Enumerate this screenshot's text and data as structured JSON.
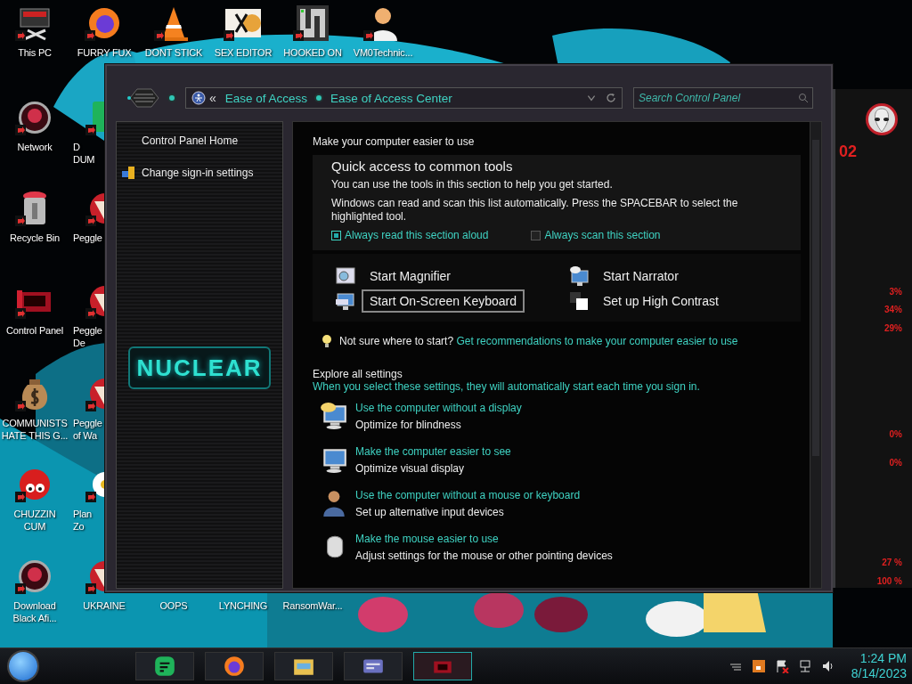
{
  "desktop": {
    "icons": [
      {
        "lines": [
          "This PC"
        ]
      },
      {
        "lines": [
          "FURRY FUX"
        ]
      },
      {
        "lines": [
          "DONT STICK"
        ]
      },
      {
        "lines": [
          "SEX EDITOR"
        ]
      },
      {
        "lines": [
          "HOOKED ON"
        ]
      },
      {
        "lines": [
          "VM0Technic..."
        ]
      },
      {
        "lines": [
          "Network"
        ]
      },
      {
        "lines": [
          "Recycle Bin"
        ]
      },
      {
        "lines": [
          "Control Panel"
        ]
      },
      {
        "lines": [
          "COMMUNISTS",
          "HATE THIS G..."
        ]
      },
      {
        "lines": [
          "CHUZZIN",
          "CUM"
        ]
      },
      {
        "lines": [
          "Download",
          "Black Afi..."
        ]
      },
      {
        "lines": [
          "D",
          "DUM"
        ]
      },
      {
        "lines": [
          "Peggle"
        ]
      },
      {
        "lines": [
          "Peggle",
          "De"
        ]
      },
      {
        "lines": [
          "Peggle",
          "of Wa"
        ]
      },
      {
        "lines": [
          "Plan",
          "Zo"
        ]
      },
      {
        "lines": [
          "UKRAINE"
        ]
      },
      {
        "lines": [
          "OOPS"
        ]
      },
      {
        "lines": [
          "LYNCHING"
        ]
      },
      {
        "lines": [
          "RansomWar..."
        ]
      }
    ]
  },
  "window": {
    "address_bar": {
      "back_glyph": "«",
      "crumbs": [
        "Ease of Access",
        "Ease of Access Center"
      ]
    },
    "search": {
      "placeholder": "Search Control Panel"
    },
    "sidebar": {
      "items": [
        {
          "label": "Control Panel Home"
        },
        {
          "label": "Change sign-in settings"
        }
      ],
      "logo": "NUCLEAR"
    },
    "main": {
      "heading": "Make your computer easier to use",
      "quick_access": {
        "title": "Quick access to common tools",
        "intro": "You can use the tools in this section to help you get started.",
        "note": "Windows can read and scan this list automatically.  Press the SPACEBAR to select the highlighted tool.",
        "options": [
          {
            "label": "Always read this section aloud",
            "checked": true
          },
          {
            "label": "Always scan this section",
            "checked": false
          }
        ]
      },
      "tools": [
        {
          "label": "Start Magnifier",
          "focused": false
        },
        {
          "label": "Start Narrator",
          "focused": false
        },
        {
          "label": "Start On-Screen Keyboard",
          "focused": true
        },
        {
          "label": "Set up High Contrast",
          "focused": false
        }
      ],
      "tip": {
        "text": "Not sure where to start?",
        "link": "Get recommendations to make your computer easier to use"
      },
      "explore": {
        "title": "Explore all settings",
        "subtitle": "When you select these settings, they will automatically start each time you sign in.",
        "items": [
          {
            "title": "Use the computer without a display",
            "description": "Optimize for blindness"
          },
          {
            "title": "Make the computer easier to see",
            "description": "Optimize visual display"
          },
          {
            "title": "Use the computer without a mouse or keyboard",
            "description": "Set up alternative input devices"
          },
          {
            "title": "Make the mouse easier to use",
            "description": "Adjust settings for the mouse or other pointing devices"
          }
        ]
      }
    }
  },
  "widget": {
    "readings": [
      "02",
      "3%",
      "34%",
      "29%",
      "0%",
      "0%",
      "27 %",
      "100 %"
    ]
  },
  "taskbar": {
    "apps": [
      {
        "selected": false
      },
      {
        "selected": false
      },
      {
        "selected": false
      },
      {
        "selected": false
      },
      {
        "selected": true
      }
    ],
    "clock": {
      "time": "1:24 PM",
      "date": "8/14/2023"
    }
  }
}
